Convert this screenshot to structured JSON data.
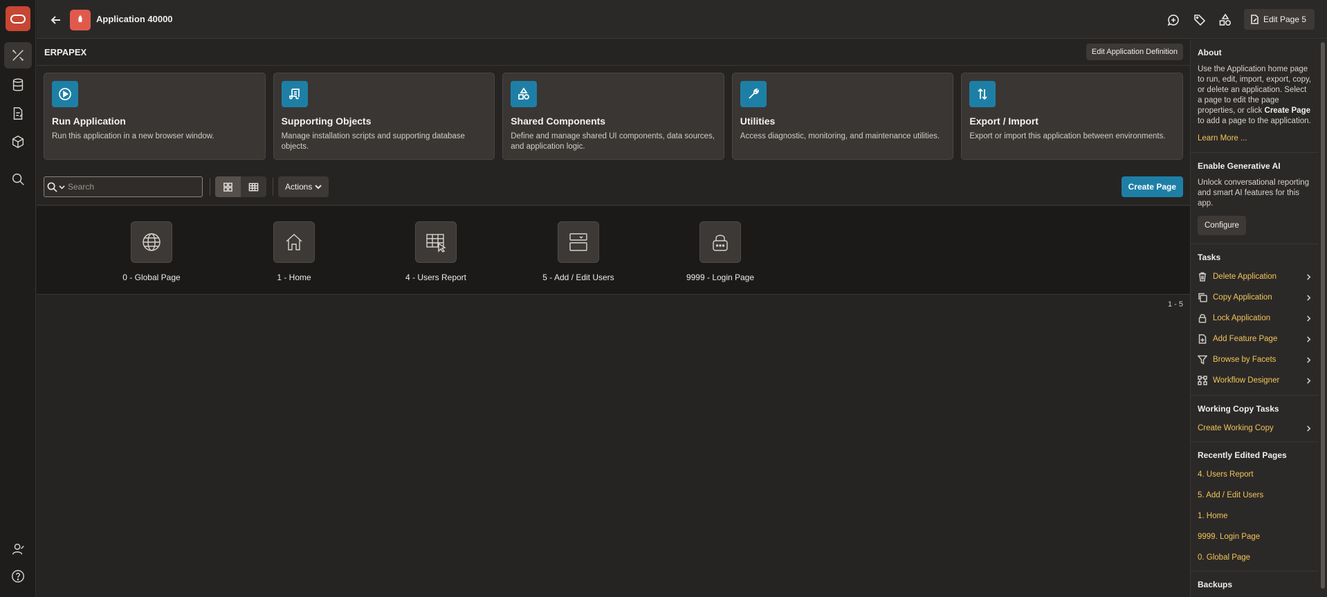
{
  "topbar": {
    "app_title": "Application 40000",
    "edit_page_label": "Edit Page 5"
  },
  "header": {
    "app_name": "ERPAPEX",
    "edit_definition_label": "Edit Application Definition"
  },
  "cards": [
    {
      "title": "Run Application",
      "desc": "Run this application in a new browser window.",
      "icon": "play-icon"
    },
    {
      "title": "Supporting Objects",
      "desc": "Manage installation scripts and supporting database objects.",
      "icon": "scroll-icon"
    },
    {
      "title": "Shared Components",
      "desc": "Define and manage shared UI components, data sources, and application logic.",
      "icon": "shapes-icon"
    },
    {
      "title": "Utilities",
      "desc": "Access diagnostic, monitoring, and maintenance utilities.",
      "icon": "wrench-icon"
    },
    {
      "title": "Export / Import",
      "desc": "Export or import this application between environments.",
      "icon": "arrows-updown-icon"
    }
  ],
  "toolbar": {
    "search_placeholder": "Search",
    "actions_label": "Actions",
    "create_page_label": "Create Page"
  },
  "pages": [
    {
      "label": "0 - Global Page",
      "icon": "globe-icon"
    },
    {
      "label": "1 - Home",
      "icon": "home-icon"
    },
    {
      "label": "4 - Users Report",
      "icon": "report-grid-icon"
    },
    {
      "label": "5 - Add / Edit Users",
      "icon": "form-icon"
    },
    {
      "label": "9999 - Login Page",
      "icon": "lock-icon"
    }
  ],
  "pagination": "1 - 5",
  "sidebar": {
    "about_title": "About",
    "about_text_1": "Use the Application home page to run, edit, import, export, copy, or delete an application. Select a page to edit the page properties, or click ",
    "about_text_bold": "Create Page",
    "about_text_2": " to add a page to the application.",
    "learn_more": "Learn More ...",
    "genai_title": "Enable Generative AI",
    "genai_text": "Unlock conversational reporting and smart AI features for this app.",
    "configure_label": "Configure",
    "tasks_title": "Tasks",
    "tasks": [
      {
        "label": "Delete Application",
        "icon": "trash-icon"
      },
      {
        "label": "Copy Application",
        "icon": "copy-icon"
      },
      {
        "label": "Lock Application",
        "icon": "lock-icon"
      },
      {
        "label": "Add Feature Page",
        "icon": "add-page-icon"
      },
      {
        "label": "Browse by Facets",
        "icon": "filter-icon"
      },
      {
        "label": "Workflow Designer",
        "icon": "workflow-icon"
      }
    ],
    "working_copy_title": "Working Copy Tasks",
    "working_copy_tasks": [
      {
        "label": "Create Working Copy"
      }
    ],
    "recent_title": "Recently Edited Pages",
    "recent": [
      "4. Users Report",
      "5. Add / Edit Users",
      "1. Home",
      "9999. Login Page",
      "0. Global Page"
    ],
    "next_title": "Backups"
  },
  "colors": {
    "accent": "#1e7fa6",
    "link": "#f2c45a",
    "brand": "#c74634"
  }
}
